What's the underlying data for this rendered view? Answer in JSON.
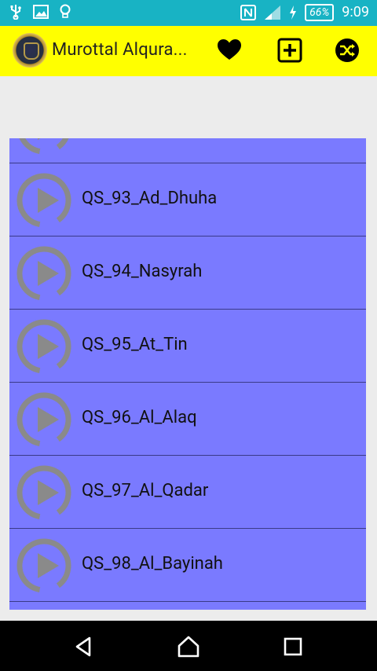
{
  "status_bar": {
    "battery": "66%",
    "time": "9:09",
    "left_icons": [
      "usb-icon",
      "image-icon",
      "lightbulb-icon"
    ],
    "right_icons": [
      "nfc-icon",
      "signal-icon",
      "charging-icon"
    ]
  },
  "action_bar": {
    "title": "Murottal Alqura...",
    "actions": [
      "favorite-icon",
      "add-box-icon",
      "shuffle-icon"
    ]
  },
  "list": {
    "items": [
      {
        "label": "QS_93_Ad_Dhuha"
      },
      {
        "label": "QS_94_Nasyrah"
      },
      {
        "label": "QS_95_At_Tin"
      },
      {
        "label": "QS_96_Al_Alaq"
      },
      {
        "label": "QS_97_Al_Qadar"
      },
      {
        "label": "QS_98_Al_Bayinah"
      }
    ]
  },
  "nav_bar": {
    "buttons": [
      "back-icon",
      "home-icon",
      "recents-icon"
    ]
  },
  "colors": {
    "status_bar": "#18b3c4",
    "action_bar": "#ffff00",
    "list_bg": "#7a7aff",
    "play_icon": "#8a8a8a"
  }
}
